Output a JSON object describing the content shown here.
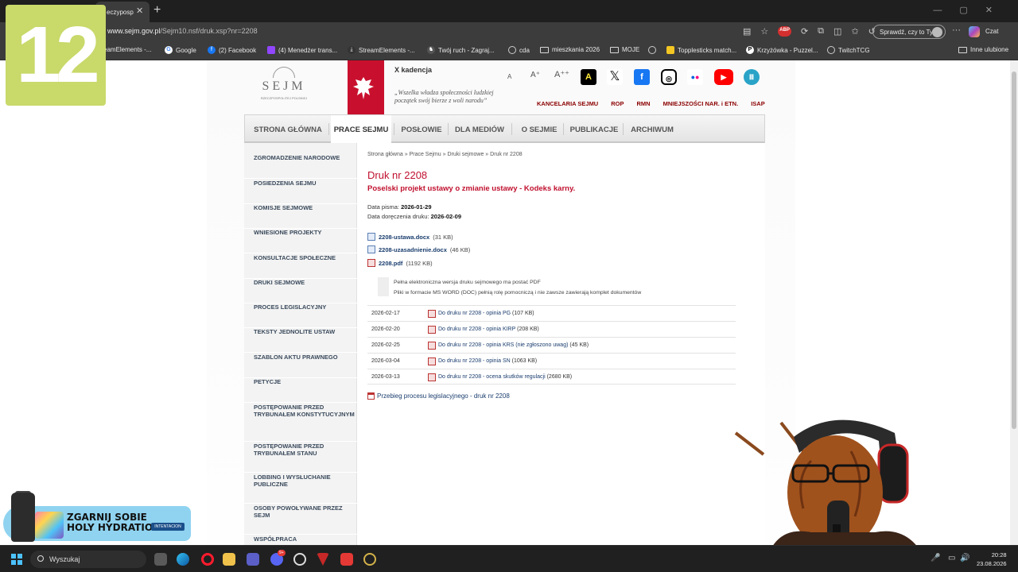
{
  "browser": {
    "tab_title": "eczyposp",
    "url_host": "www.sejm.gov.pl",
    "url_path": "/Sejm10.nsf/druk.xsp?nr=2208",
    "sprawdz_label": "Sprawdź, czy to Ty",
    "czat_label": "Czat",
    "abp_label": "ABP",
    "bookmarks": [
      "eamElements -...",
      "Google",
      "(2) Facebook",
      "(4) Menedżer trans...",
      "StreamElements -...",
      "Twój ruch - Zagraj...",
      "cda",
      "mieszkania 2026",
      "MOJE",
      "Topplesticks match...",
      "Krzyżówka - Puzzel...",
      "TwitchTCG"
    ],
    "other_bookmarks": "Inne ulubione"
  },
  "header": {
    "logo_word": "SEJM",
    "logo_sub": "RZECZPOSPOLITEJ POLSKIEJ",
    "kadencja": "X kadencja",
    "motto": "„Wszelka władza społeczności ludzkiej początek swój bierze z woli narodu”",
    "accessibility": [
      "A",
      "A⁺",
      "A⁺⁺"
    ],
    "contrast": "A",
    "top_links": [
      "KANCELARIA SEJMU",
      "ROP",
      "RMN",
      "MNIEJSZOŚCI NAR. i ETN.",
      "ISAP"
    ]
  },
  "nav": [
    "STRONA GŁÓWNA",
    "PRACE SEJMU",
    "POSŁOWIE",
    "DLA MEDIÓW",
    "O SEJMIE",
    "PUBLIKACJE",
    "ARCHIWUM"
  ],
  "sidebar": [
    "ZGROMADZENIE NARODOWE",
    "POSIEDZENIA SEJMU",
    "KOMISJE SEJMOWE",
    "WNIESIONE PROJEKTY",
    "KONSULTACJE SPOŁECZNE",
    "DRUKI SEJMOWE",
    "PROCES LEGISLACYJNY",
    "TEKSTY JEDNOLITE USTAW",
    "SZABLON AKTU PRAWNEGO",
    "PETYCJE",
    "POSTĘPOWANIE PRZED TRYBUNAŁEM KONSTYTUCYJNYM",
    "POSTĘPOWANIE PRZED TRYBUNAŁEM STANU",
    "LOBBING I WYSŁUCHANIE PUBLICZNE",
    "OSOBY POWOŁYWANE PRZEZ SEJM",
    "WSPÓŁPRACA"
  ],
  "main": {
    "breadcrumb": [
      "Strona główna",
      "Prace Sejmu",
      "Druki sejmowe",
      "Druk nr 2208"
    ],
    "title": "Druk nr 2208",
    "subtitle": "Poselski projekt ustawy o zmianie ustawy - Kodeks karny.",
    "data_pisma_label": "Data pisma:",
    "data_pisma": "2026-01-29",
    "data_dor_label": "Data doręczenia druku:",
    "data_dor": "2026-02-09",
    "files": [
      {
        "name": "2208-ustawa.docx",
        "size": "(31 KB)",
        "type": "doc"
      },
      {
        "name": "2208-uzasadnienie.docx",
        "size": "(46 KB)",
        "type": "doc"
      },
      {
        "name": "2208.pdf",
        "size": "(1192 KB)",
        "type": "pdf"
      }
    ],
    "note1": "Pełna elektroniczna wersja druku sejmowego ma postać PDF",
    "note2": "Pliki w formacie MS WORD (DOC) pełnią rolę pomocniczą i nie zawsze zawierają komplet dokumentów",
    "opinions": [
      {
        "date": "2026-02-17",
        "title": "Do druku nr 2208 - opinia PG",
        "size": "(107 KB)"
      },
      {
        "date": "2026-02-20",
        "title": "Do druku nr 2208 - opinia KIRP",
        "size": "(208 KB)"
      },
      {
        "date": "2026-02-25",
        "title": "Do druku nr 2208 - opinia KRS (nie zgłoszono uwag)",
        "size": "(45 KB)"
      },
      {
        "date": "2026-03-04",
        "title": "Do druku nr 2208 - opinia SN",
        "size": "(1063 KB)"
      },
      {
        "date": "2026-03-13",
        "title": "Do druku nr 2208 - ocena skutków regulacji",
        "size": "(2680 KB)"
      }
    ],
    "przebieg": "Przebieg procesu legislacyjnego - druk nr 2208"
  },
  "overlay": {
    "badge": "12",
    "promo_line1": "ZGARNIJ SOBIE",
    "promo_line2": "HOLY HYDRATION",
    "promo_tag": "INTENTACION"
  },
  "taskbar": {
    "search_placeholder": "Wyszukaj",
    "time": "20:28",
    "date": "23.08.2026",
    "discord_badge": "9+"
  },
  "colors": {
    "sejm_red": "#c0102e",
    "link_blue": "#1a3d6e",
    "badge_green": "#c9d96a"
  }
}
